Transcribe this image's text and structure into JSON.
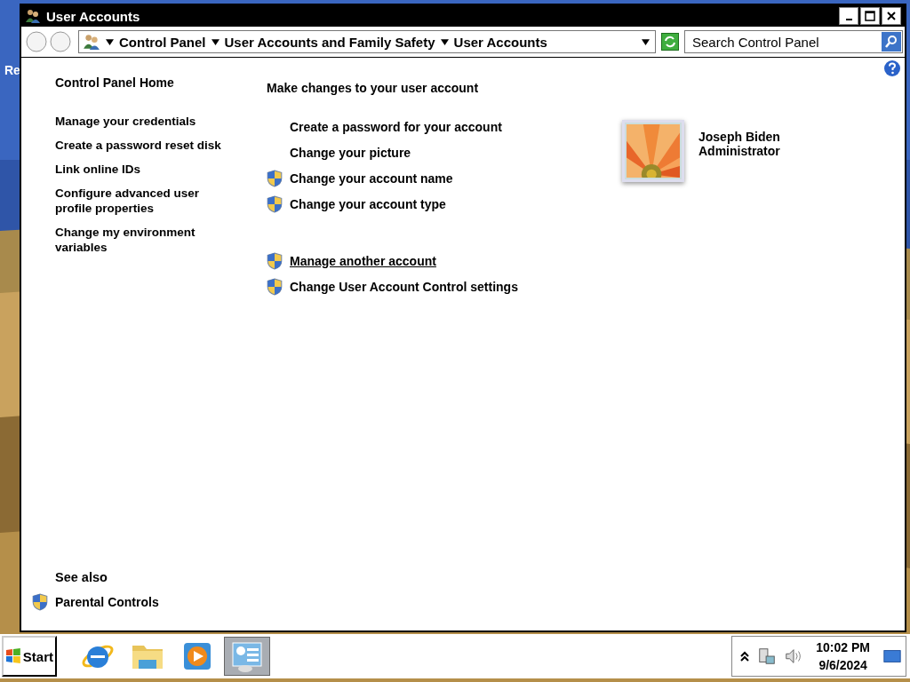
{
  "desktop": {
    "icon_label": "Re"
  },
  "window": {
    "title": "User Accounts"
  },
  "address_bar": {
    "breadcrumbs": [
      "Control Panel",
      "User Accounts and Family Safety",
      "User Accounts"
    ]
  },
  "search": {
    "placeholder": "Search Control Panel"
  },
  "sidebar": {
    "home": "Control Panel Home",
    "items": [
      {
        "label": "Manage your credentials"
      },
      {
        "label": "Create a password reset disk"
      },
      {
        "label": "Link online IDs"
      },
      {
        "label": "Configure advanced user profile properties"
      },
      {
        "label": "Change my environment variables"
      }
    ],
    "see_also": {
      "heading": "See also",
      "items": [
        {
          "label": "Parental Controls",
          "shield": true
        }
      ]
    }
  },
  "main": {
    "heading": "Make changes to your user account",
    "tasks": [
      {
        "label": "Create a password for your account",
        "shield": false,
        "hovered": false
      },
      {
        "label": "Change your picture",
        "shield": false,
        "hovered": false
      },
      {
        "label": "Change your account name",
        "shield": true,
        "hovered": false
      },
      {
        "label": "Change your account type",
        "shield": true,
        "hovered": false
      }
    ],
    "other_tasks": [
      {
        "label": "Manage another account",
        "shield": true,
        "hovered": true
      },
      {
        "label": "Change User Account Control settings",
        "shield": true,
        "hovered": false
      }
    ]
  },
  "account": {
    "name": "Joseph Biden",
    "role": "Administrator"
  },
  "taskbar": {
    "start": "Start",
    "apps": [
      {
        "kind": "browser",
        "selected": false
      },
      {
        "kind": "folder",
        "selected": false
      },
      {
        "kind": "media",
        "selected": false
      },
      {
        "kind": "panel",
        "selected": true
      }
    ],
    "time": "10:02 PM",
    "date": "9/6/2024"
  }
}
